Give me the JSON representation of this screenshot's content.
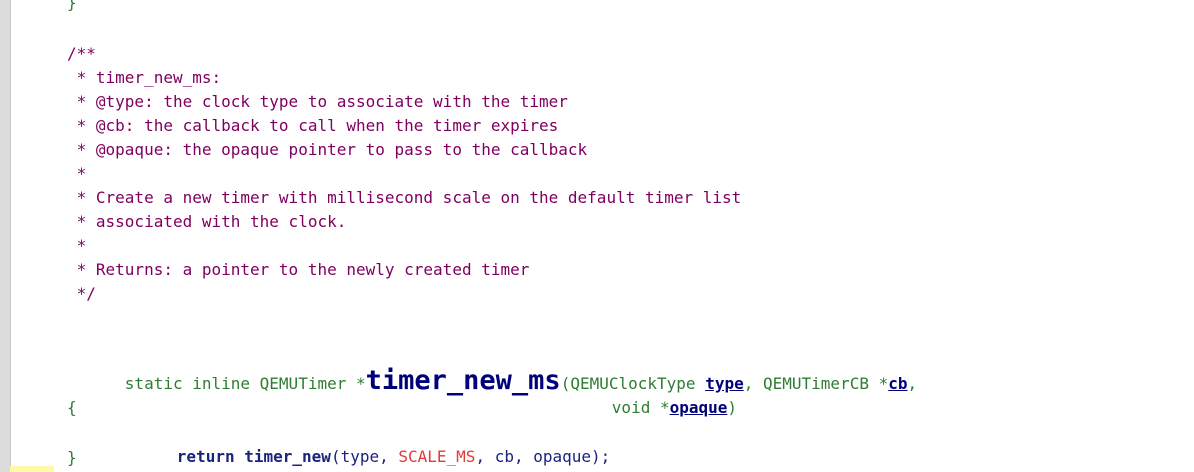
{
  "editor": {
    "prev_close_brace": "}",
    "comment": {
      "open": "/**",
      "name_line": " * timer_new_ms:",
      "type_line": " * @type: the clock type to associate with the timer",
      "cb_line": " * @cb: the callback to call when the timer expires",
      "opaque_line": " * @opaque: the opaque pointer to pass to the callback",
      "blank1": " *",
      "desc_line1": " * Create a new timer with millisecond scale on the default timer list",
      "desc_line2": " * associated with the clock.",
      "blank2": " *",
      "returns_line": " * Returns: a pointer to the newly created timer",
      "close": " */"
    },
    "signature": {
      "prefix": "static inline QEMUTimer *",
      "func_name": "timer_new_ms",
      "open_paren_type": "(QEMUClockType ",
      "param_type": "type",
      "comma_cb_type": ", QEMUTimerCB *",
      "param_cb": "cb",
      "trailing_comma": ",",
      "void_ptr": "void *",
      "param_opaque": "opaque",
      "close_paren": ")"
    },
    "body": {
      "open_brace": "{",
      "return_kw": "return ",
      "call_name": "timer_new",
      "arg_open_type": "(type, ",
      "macro_scale": "SCALE_MS",
      "arg_rest": ", cb, opaque);",
      "close_brace": "}"
    }
  }
}
